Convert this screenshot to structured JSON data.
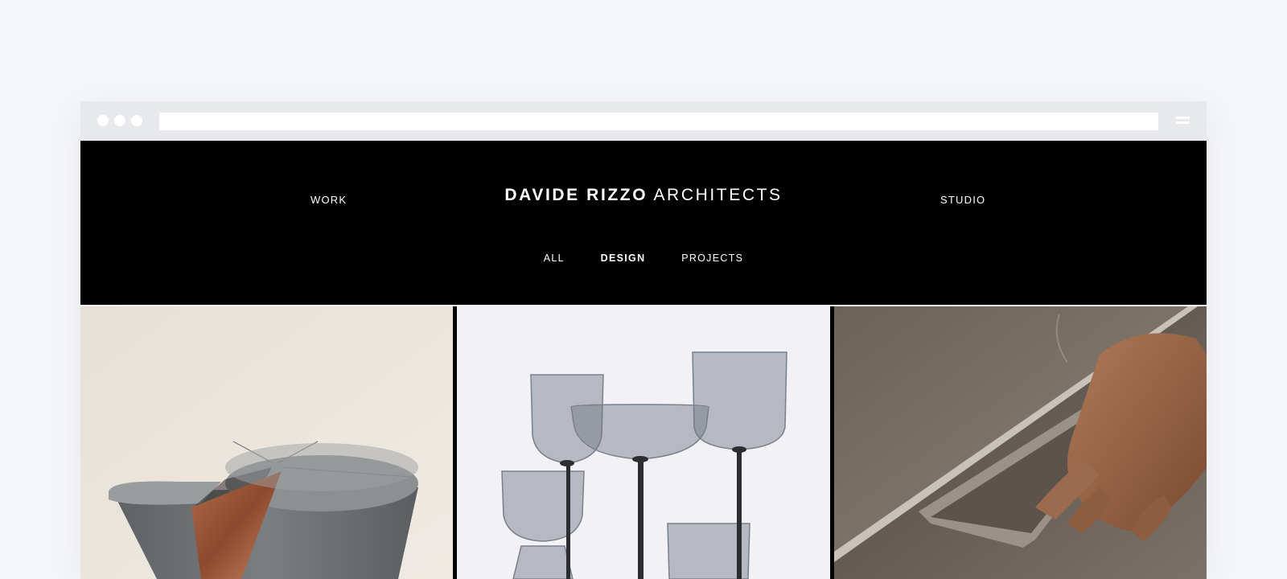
{
  "site": {
    "logo_bold": "DAVIDE RIZZO",
    "logo_light": "ARCHITECTS",
    "nav": {
      "work": "WORK",
      "studio": "STUDIO"
    },
    "filters": [
      {
        "label": "ALL",
        "active": false
      },
      {
        "label": "DESIGN",
        "active": true
      },
      {
        "label": "PROJECTS",
        "active": false
      }
    ]
  },
  "gallery": [
    {
      "subject": "side table with copper inlay"
    },
    {
      "subject": "smoked glassware set"
    },
    {
      "subject": "kitchen handle detail"
    }
  ],
  "colors": {
    "page_bg": "#f5f6f8",
    "chrome_bg": "#e7e9ec",
    "header_bg": "#000000",
    "text_on_dark": "#ffffff"
  }
}
